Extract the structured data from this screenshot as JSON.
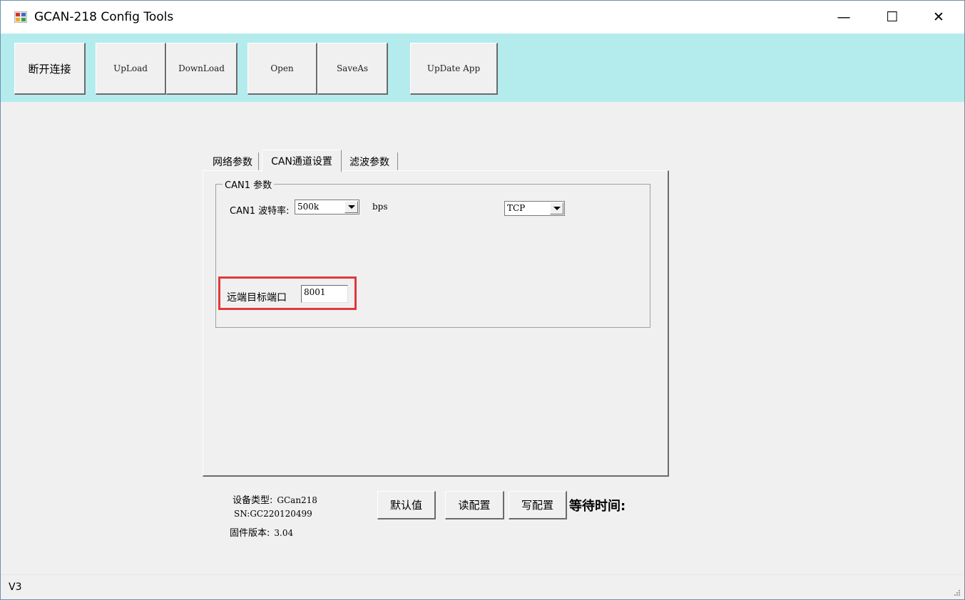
{
  "window": {
    "title": "GCAN-218 Config Tools",
    "controls": {
      "minimize": "—",
      "maximize": "☐",
      "close": "✕"
    }
  },
  "toolbar": {
    "buttons": [
      "断开连接",
      "UpLoad",
      "DownLoad",
      "Open",
      "SaveAs",
      "UpDate App"
    ],
    "background": "#b4ecee"
  },
  "tabs": [
    "网络参数",
    "CAN通道设置",
    "滤波参数"
  ],
  "active_tab": "CAN通道设置",
  "group": {
    "legend": "CAN1 参数",
    "baud_label": "CAN1 波特率:",
    "baud_value": "500k",
    "baud_unit": "bps",
    "protocol_value": "TCP",
    "port_label": "远端目标端口",
    "port_value": "8001"
  },
  "device_info": {
    "type_label": "设备类型:",
    "type_value": "GCan218",
    "sn": "SN:GC220120499",
    "fw_label": "固件版本:",
    "fw_value": "3.04"
  },
  "actions": {
    "default": "默认值",
    "read": "读配置",
    "write": "写配置",
    "wait_label": "等待时间:"
  },
  "status": {
    "text": "V3"
  },
  "colors": {
    "highlight": "#e0393b",
    "toolbar": "#b4ecee"
  },
  "icons": [
    "app-icon",
    "minimize-icon",
    "maximize-icon",
    "close-icon",
    "dropdown-arrow-icon",
    "resize-grip-icon"
  ]
}
